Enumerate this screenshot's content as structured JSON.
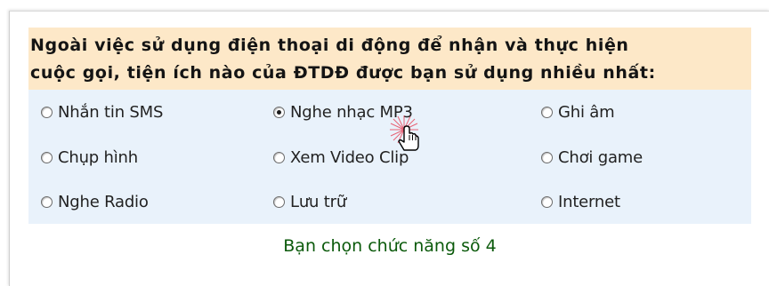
{
  "question": {
    "line1": "Ngoài việc sử dụng điện thoại di động để nhận và thực hiện",
    "line2": "cuộc gọi, tiện ích nào của ĐTDĐ được bạn sử dụng nhiều nhất:"
  },
  "options": [
    {
      "label": "Nhắn tin SMS",
      "checked": false
    },
    {
      "label": "Nghe nhạc MP3",
      "checked": true
    },
    {
      "label": "Ghi âm",
      "checked": false
    },
    {
      "label": "Chụp hình",
      "checked": false
    },
    {
      "label": "Xem Video Clip",
      "checked": false
    },
    {
      "label": "Chơi game",
      "checked": false
    },
    {
      "label": "Nghe Radio",
      "checked": false
    },
    {
      "label": "Lưu trữ",
      "checked": false
    },
    {
      "label": "Internet",
      "checked": false
    }
  ],
  "result": {
    "text": "Bạn chọn chức năng số 4"
  },
  "colors": {
    "question_background": "#fde8c8",
    "options_background": "#e9f2fb",
    "result_text": "#0b5a0b",
    "click_burst": "#e8334a"
  },
  "cursor": {
    "icon": "hand-pointer-icon"
  }
}
